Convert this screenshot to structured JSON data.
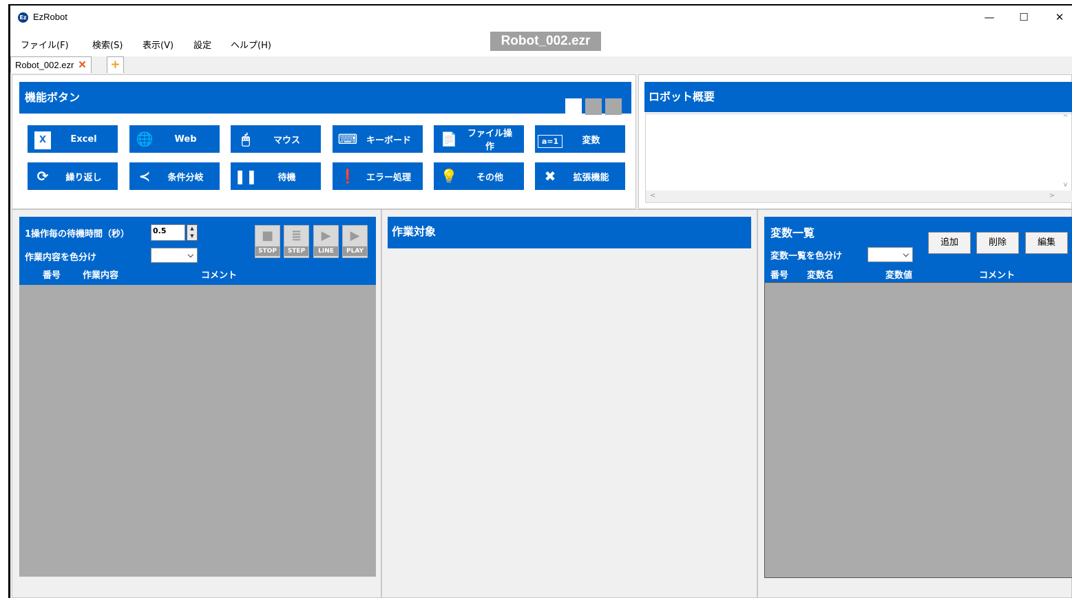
{
  "app": {
    "title": "EzRobot",
    "icon_text": "Ez",
    "file_title": "Robot_002.ezr"
  },
  "window_controls": {
    "minimize": "—",
    "maximize": "☐",
    "close": "✕"
  },
  "menu": [
    "ファイル(F)",
    "検索(S)",
    "表示(V)",
    "設定",
    "ヘルプ(H)"
  ],
  "tabs": {
    "doc": "Robot_002.ezr",
    "close": "✕",
    "add": "+"
  },
  "func_panel": {
    "title": "機能ボタン",
    "view_squares": [
      "#ffffff",
      "#a8a8a8",
      "#a8a8a8"
    ],
    "buttons": [
      {
        "label": "Excel",
        "icon": "excel-icon",
        "glyph": "X"
      },
      {
        "label": "Web",
        "icon": "globe-icon",
        "glyph": "🌐"
      },
      {
        "label": "マウス",
        "icon": "mouse-icon",
        "glyph": "🖱"
      },
      {
        "label": "キーボード",
        "icon": "keyboard-icon",
        "glyph": "⌨"
      },
      {
        "label": "ファイル操作",
        "icon": "file-icon",
        "glyph": "📄"
      },
      {
        "label": "変数",
        "icon": "variable-icon",
        "glyph": "a=1"
      },
      {
        "label": "繰り返し",
        "icon": "loop-icon",
        "glyph": "⟳"
      },
      {
        "label": "条件分岐",
        "icon": "branch-icon",
        "glyph": "≺"
      },
      {
        "label": "待機",
        "icon": "pause-icon",
        "glyph": "❚❚"
      },
      {
        "label": "エラー処理",
        "icon": "error-icon",
        "glyph": "❗"
      },
      {
        "label": "その他",
        "icon": "lightbulb-icon",
        "glyph": "💡"
      },
      {
        "label": "拡張機能",
        "icon": "tools-icon",
        "glyph": "✖"
      }
    ]
  },
  "robot_panel": {
    "title": "ロボット概要",
    "scroll_up": "^",
    "scroll_down": "v",
    "scroll_left": "<",
    "scroll_right": ">"
  },
  "task_panel": {
    "wait_label": "1操作毎の待機時間（秒）",
    "wait_value": "0.5",
    "spin_up": "▲",
    "spin_down": "▼",
    "color_label": "作業内容を色分け",
    "select_arrow": "⌵",
    "columns": {
      "no": "番号",
      "content": "作業内容",
      "comment": "コメント"
    },
    "controls": [
      {
        "label": "STOP",
        "icon": "stop-icon",
        "glyph": "■"
      },
      {
        "label": "STEP",
        "icon": "step-icon",
        "glyph": "≣"
      },
      {
        "label": "LINE",
        "icon": "line-icon",
        "glyph": "▶"
      },
      {
        "label": "PLAY",
        "icon": "play-icon",
        "glyph": "▶"
      }
    ]
  },
  "work_panel": {
    "title": "作業対象"
  },
  "vars_panel": {
    "title": "変数一覧",
    "color_label": "変数一覧を色分け",
    "select_arrow": "⌵",
    "buttons": {
      "add": "追加",
      "delete": "削除",
      "edit": "編集"
    },
    "columns": {
      "no": "番号",
      "name": "変数名",
      "value": "変数値",
      "comment": "コメント"
    }
  },
  "colors": {
    "accent": "#0066cc",
    "list_bg": "#ababab",
    "window_bg": "#f0f0f0"
  }
}
